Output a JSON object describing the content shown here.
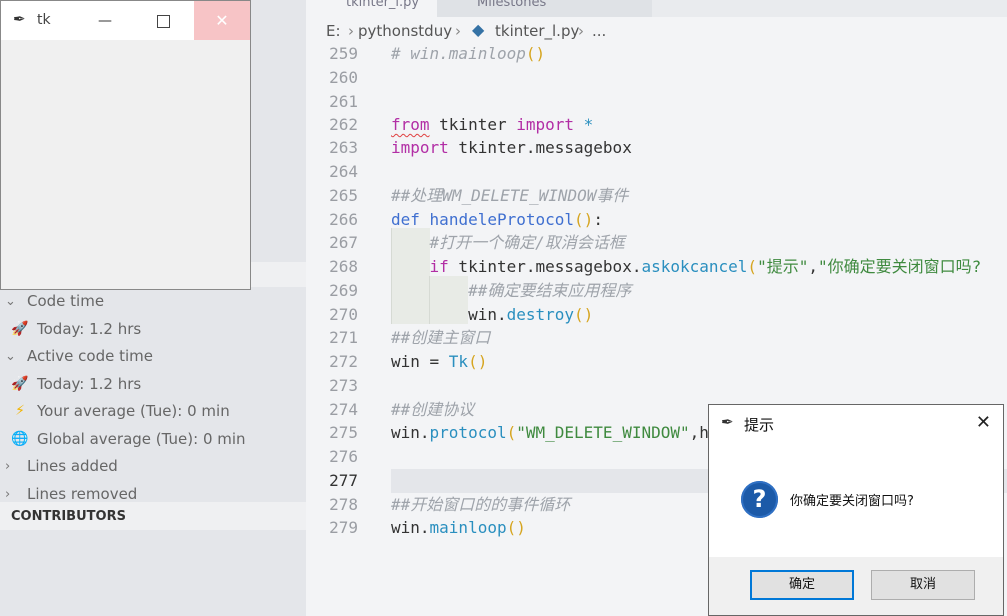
{
  "editor": {
    "tabs": [
      {
        "label": "tkinter_l.py"
      },
      {
        "label": "Milestones"
      }
    ],
    "breadcrumb": {
      "drive": "E:",
      "folder": "pythonstduy",
      "file": "tkinter_l.py",
      "more": "..."
    },
    "current_line": "277"
  },
  "sidebar": {
    "items": [
      {
        "label": "Code time",
        "kind": "section",
        "icon": "chevron-down-icon"
      },
      {
        "label": "Today: 1.2 hrs",
        "kind": "item",
        "icon": "rocket-icon"
      },
      {
        "label": "Active code time",
        "kind": "section",
        "icon": "chevron-down-icon"
      },
      {
        "label": "Today: 1.2 hrs",
        "kind": "item",
        "icon": "rocket-icon"
      },
      {
        "label": "Your average (Tue): 0 min",
        "kind": "item",
        "icon": "lightning-icon"
      },
      {
        "label": "Global average (Tue): 0 min",
        "kind": "item",
        "icon": "globe-icon"
      },
      {
        "label": "Lines added",
        "kind": "section",
        "icon": "chevron-right-icon"
      },
      {
        "label": "Lines removed",
        "kind": "section",
        "icon": "chevron-right-icon"
      }
    ],
    "contributors_header": "CONTRIBUTORS"
  },
  "tk_window": {
    "title": "tk",
    "minimize_glyph": "—",
    "close_glyph": "✕"
  },
  "dialog": {
    "title": "提示",
    "message": "你确定要关闭窗口吗?",
    "ok_label": "确定",
    "cancel_label": "取消",
    "close_glyph": "✕",
    "icon": "question-icon"
  },
  "colors": {
    "keyword": "#b22ea5",
    "function": "#2a8fbf",
    "string": "#3f8a3f",
    "comment": "#9ea3aa",
    "dialog_default_button_border": "#0078d7",
    "question_icon": "#1c5aa8"
  }
}
